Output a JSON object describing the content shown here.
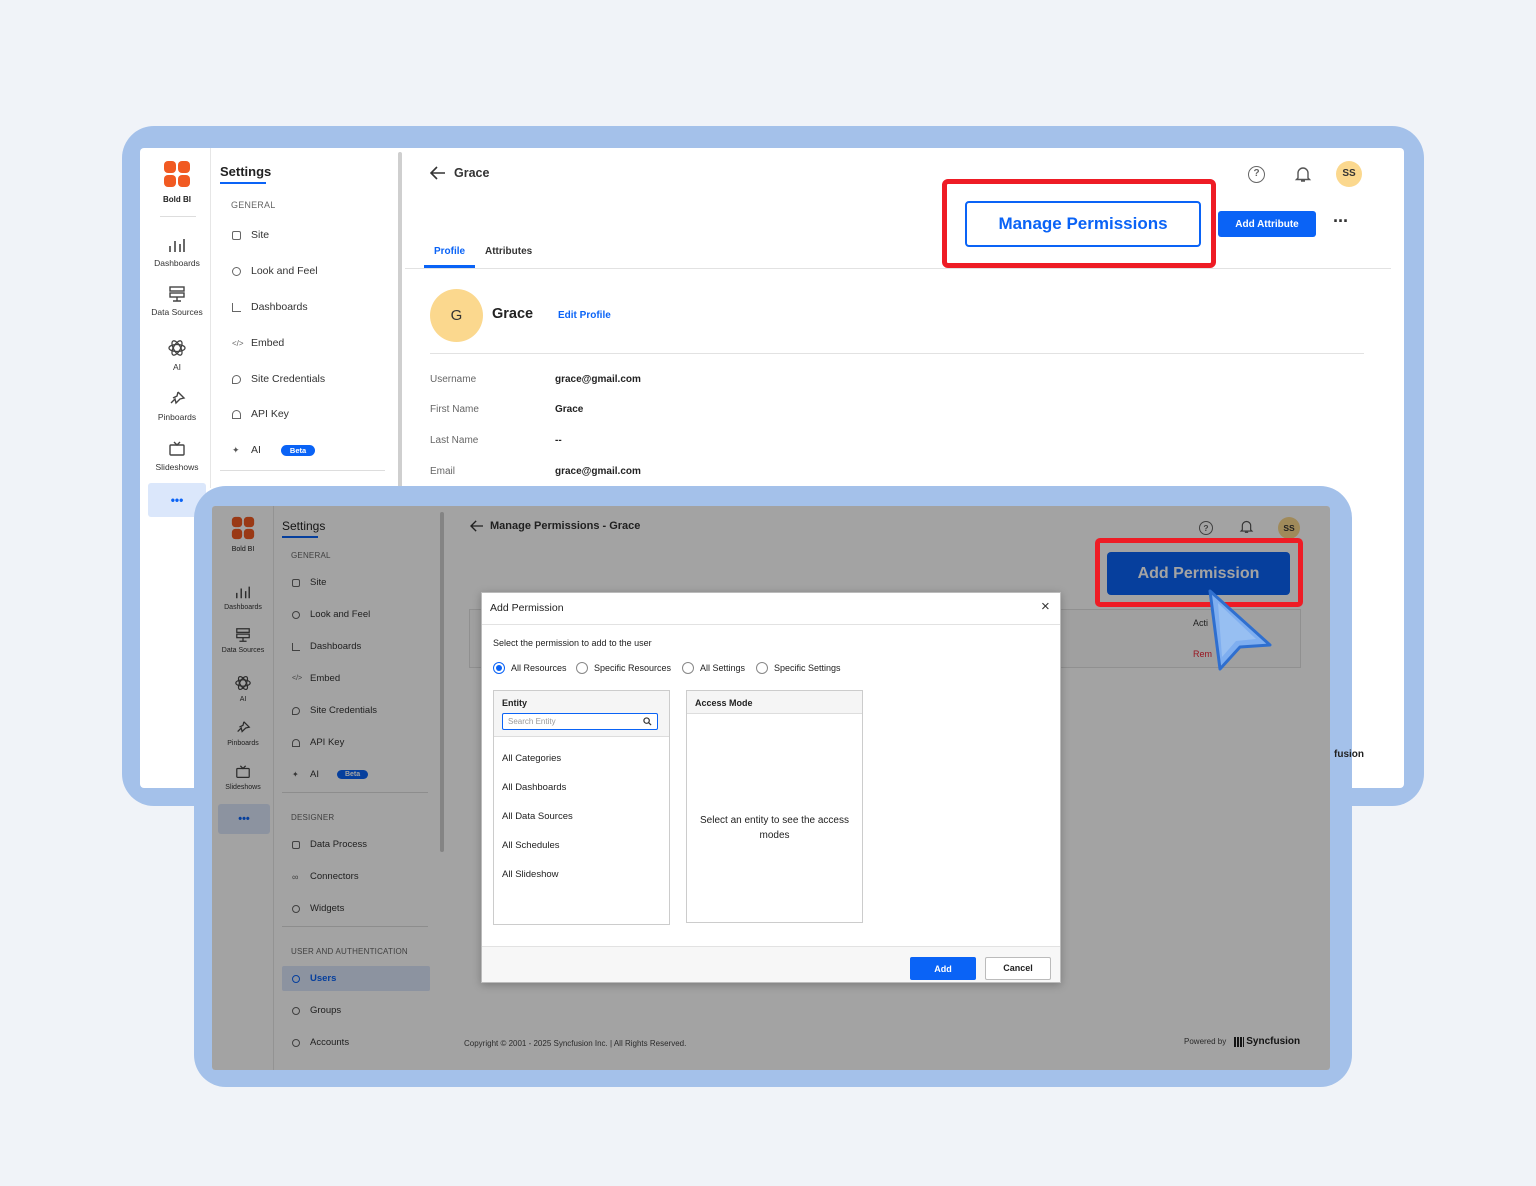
{
  "brand": {
    "name": "Bold BI",
    "orange": "#f15a22",
    "accent": "#0a63f6"
  },
  "rail": {
    "items": [
      {
        "label": "Dashboards",
        "icon": "chart-icon"
      },
      {
        "label": "Data Sources",
        "icon": "datasource-icon"
      },
      {
        "label": "AI",
        "icon": "atom-icon"
      },
      {
        "label": "Pinboards",
        "icon": "pin-icon"
      },
      {
        "label": "Slideshows",
        "icon": "tv-icon"
      }
    ],
    "more": "•••"
  },
  "settings": {
    "title": "Settings",
    "general": "GENERAL",
    "items": [
      "Site",
      "Look and Feel",
      "Dashboards",
      "Embed",
      "Site Credentials",
      "API Key",
      "AI"
    ],
    "beta": "Beta",
    "designer": "DESIGNER",
    "designer_items": [
      "Data Process",
      "Connectors",
      "Widgets"
    ],
    "user_auth": "USER AND AUTHENTICATION",
    "user_items": [
      "Users",
      "Groups",
      "Accounts"
    ]
  },
  "back": {
    "title": "Grace",
    "title2": "Manage Permissions - Grace"
  },
  "header": {
    "avatar": "SS"
  },
  "actions": {
    "manage": "Manage Permissions",
    "add_attr": "Add Attribute",
    "more": "···",
    "add_perm": "Add Permission"
  },
  "tabs": {
    "profile": "Profile",
    "attributes": "Attributes"
  },
  "profile": {
    "initial": "G",
    "name": "Grace",
    "edit": "Edit Profile",
    "fields": [
      {
        "label": "Username",
        "value": "grace@gmail.com"
      },
      {
        "label": "First Name",
        "value": "Grace"
      },
      {
        "label": "Last Name",
        "value": "--"
      },
      {
        "label": "Email",
        "value": "grace@gmail.com"
      }
    ]
  },
  "dialog": {
    "title": "Add Permission",
    "close": "×",
    "prompt": "Select the permission to add to the user",
    "options": [
      "All Resources",
      "Specific Resources",
      "All Settings",
      "Specific Settings"
    ],
    "entity": "Entity",
    "search_ph": "Search Entity",
    "entities": [
      "All Categories",
      "All Dashboards",
      "All Data Sources",
      "All Schedules",
      "All Slideshow"
    ],
    "access": "Access Mode",
    "access_hint": "Select an entity to see the access modes",
    "add": "Add",
    "cancel": "Cancel"
  },
  "bg_fragments": {
    "actions": "Acti",
    "remove": "Rem",
    "brand_tail": "fusion"
  },
  "footer": {
    "copyright": "Copyright © 2001 - 2025 Syncfusion Inc. | All Rights Reserved.",
    "powered": "Powered by",
    "brand": "Syncfusion"
  }
}
